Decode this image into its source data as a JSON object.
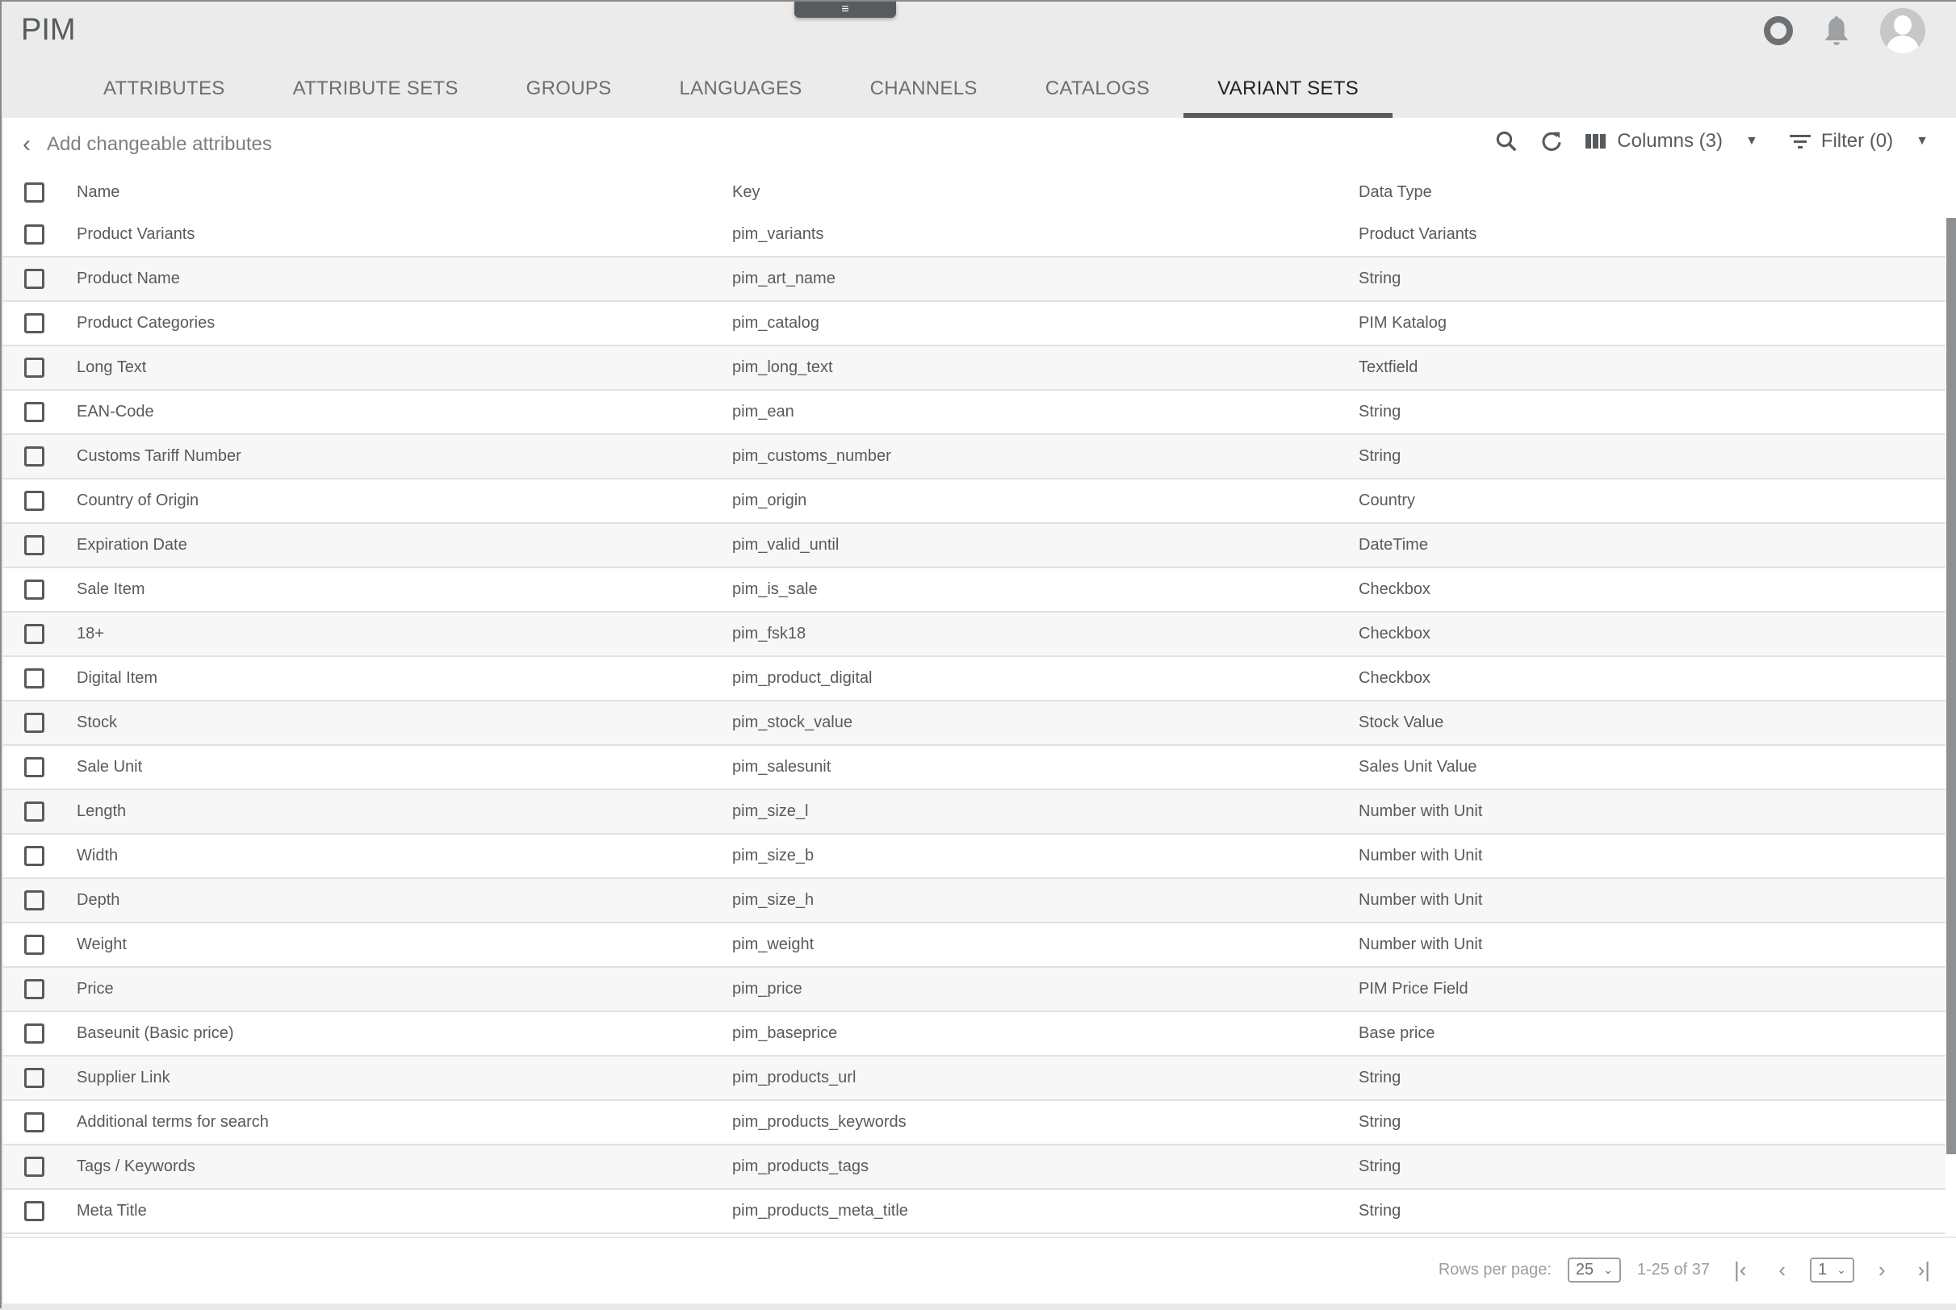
{
  "app": {
    "title": "PIM"
  },
  "icons": {
    "drawer": "menu-icon",
    "status": "status-ring-icon",
    "notifications": "bell-icon",
    "account": "avatar-icon"
  },
  "tabs": [
    {
      "label": "ATTRIBUTES",
      "active": false
    },
    {
      "label": "ATTRIBUTE SETS",
      "active": false
    },
    {
      "label": "GROUPS",
      "active": false
    },
    {
      "label": "LANGUAGES",
      "active": false
    },
    {
      "label": "CHANNELS",
      "active": false
    },
    {
      "label": "CATALOGS",
      "active": false
    },
    {
      "label": "VARIANT SETS",
      "active": true
    }
  ],
  "toolbar": {
    "back_label": "Add changeable attributes",
    "columns_label": "Columns (3)",
    "filter_label": "Filter (0)"
  },
  "table": {
    "headers": {
      "name": "Name",
      "key": "Key",
      "type": "Data Type"
    },
    "rows": [
      {
        "name": "Product Variants",
        "key": "pim_variants",
        "type": "Product Variants"
      },
      {
        "name": "Product Name",
        "key": "pim_art_name",
        "type": "String"
      },
      {
        "name": "Product Categories",
        "key": "pim_catalog",
        "type": "PIM Katalog"
      },
      {
        "name": "Long Text",
        "key": "pim_long_text",
        "type": "Textfield"
      },
      {
        "name": "EAN-Code",
        "key": "pim_ean",
        "type": "String"
      },
      {
        "name": "Customs Tariff Number",
        "key": "pim_customs_number",
        "type": "String"
      },
      {
        "name": "Country of Origin",
        "key": "pim_origin",
        "type": "Country"
      },
      {
        "name": "Expiration Date",
        "key": "pim_valid_until",
        "type": "DateTime"
      },
      {
        "name": "Sale Item",
        "key": "pim_is_sale",
        "type": "Checkbox"
      },
      {
        "name": "18+",
        "key": "pim_fsk18",
        "type": "Checkbox"
      },
      {
        "name": "Digital Item",
        "key": "pim_product_digital",
        "type": "Checkbox"
      },
      {
        "name": "Stock",
        "key": "pim_stock_value",
        "type": "Stock Value"
      },
      {
        "name": "Sale Unit",
        "key": "pim_salesunit",
        "type": "Sales Unit Value"
      },
      {
        "name": "Length",
        "key": "pim_size_l",
        "type": "Number with Unit"
      },
      {
        "name": "Width",
        "key": "pim_size_b",
        "type": "Number with Unit"
      },
      {
        "name": "Depth",
        "key": "pim_size_h",
        "type": "Number with Unit"
      },
      {
        "name": "Weight",
        "key": "pim_weight",
        "type": "Number with Unit"
      },
      {
        "name": "Price",
        "key": "pim_price",
        "type": "PIM Price Field"
      },
      {
        "name": "Baseunit (Basic price)",
        "key": "pim_baseprice",
        "type": "Base price"
      },
      {
        "name": "Supplier Link",
        "key": "pim_products_url",
        "type": "String"
      },
      {
        "name": "Additional terms for search",
        "key": "pim_products_keywords",
        "type": "String"
      },
      {
        "name": "Tags / Keywords",
        "key": "pim_products_tags",
        "type": "String"
      },
      {
        "name": "Meta Title",
        "key": "pim_products_meta_title",
        "type": "String"
      }
    ]
  },
  "pagination": {
    "rows_per_page_label": "Rows per page:",
    "rows_per_page": "25",
    "range": "1-25 of 37",
    "page": "1"
  }
}
